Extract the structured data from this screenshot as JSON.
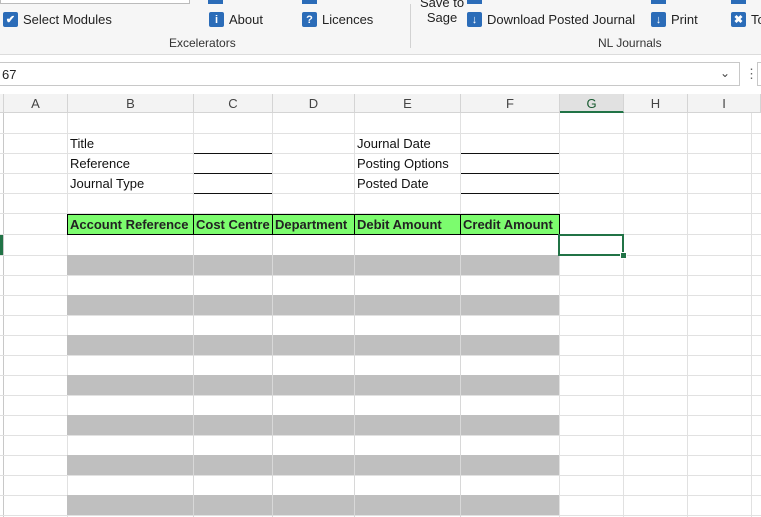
{
  "ribbon": {
    "excelerators": {
      "label": "Excelerators",
      "buttons": [
        "Select Modules",
        "About",
        "Licences"
      ]
    },
    "nl_journals": {
      "label": "NL Journals",
      "save_to_sage_line1": "Save to",
      "save_to_sage_line2": "Sage",
      "download": "Download Posted Journal",
      "print": "Print",
      "tools": "To"
    }
  },
  "formula_bar": {
    "name_box": "67"
  },
  "columns": [
    "A",
    "B",
    "C",
    "D",
    "E",
    "F",
    "G",
    "H",
    "I"
  ],
  "selected_column": "G",
  "form": {
    "left_labels": [
      "Title",
      "Reference",
      "Journal Type"
    ],
    "right_labels": [
      "Journal Date",
      "Posting Options",
      "Posted Date"
    ]
  },
  "table": {
    "headers": [
      "Account Reference",
      "Cost Centre",
      "Department",
      "Debit Amount",
      "Credit Amount"
    ],
    "header_color": "#7cfc6e",
    "band_color": "#bfbfbf"
  },
  "accent_color": "#217346"
}
